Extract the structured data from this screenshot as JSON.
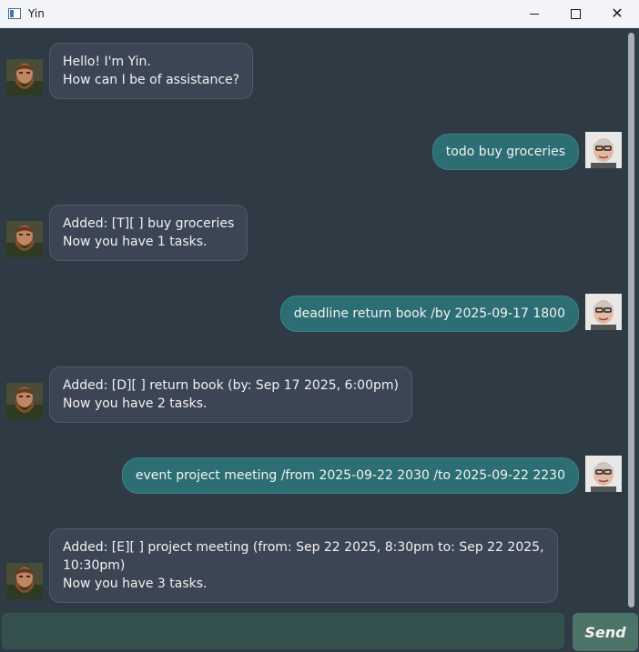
{
  "window": {
    "title": "Yin",
    "controls": {
      "minimize_icon": "minimize-icon",
      "maximize_icon": "maximize-icon",
      "close_icon": "close-icon",
      "close_glyph": "✕"
    }
  },
  "colors": {
    "bot_bubble": "#3c4553",
    "user_bubble": "#2c6e73",
    "background": "#2f3b44",
    "input": "#34514f",
    "send_button": "#4b7368"
  },
  "messages": [
    {
      "sender": "bot",
      "lines": [
        "Hello! I'm Yin.",
        "How can I be of assistance?"
      ]
    },
    {
      "sender": "user",
      "lines": [
        "todo buy groceries"
      ]
    },
    {
      "sender": "bot",
      "lines": [
        "Added: [T][ ] buy groceries",
        "Now you have 1 tasks."
      ]
    },
    {
      "sender": "user",
      "lines": [
        "deadline return book /by 2025-09-17 1800"
      ]
    },
    {
      "sender": "bot",
      "lines": [
        "Added: [D][ ] return book (by: Sep 17 2025, 6:00pm)",
        "Now you have 2 tasks."
      ]
    },
    {
      "sender": "user",
      "lines": [
        "event project meeting /from 2025-09-22 2030 /to 2025-09-22 2230"
      ]
    },
    {
      "sender": "bot",
      "lines": [
        "Added: [E][ ] project meeting (from: Sep 22 2025, 8:30pm to: Sep 22 2025,",
        "10:30pm)",
        "Now you have 3 tasks."
      ]
    }
  ],
  "input": {
    "value": "",
    "placeholder": ""
  },
  "send_button": {
    "label": "Send"
  }
}
